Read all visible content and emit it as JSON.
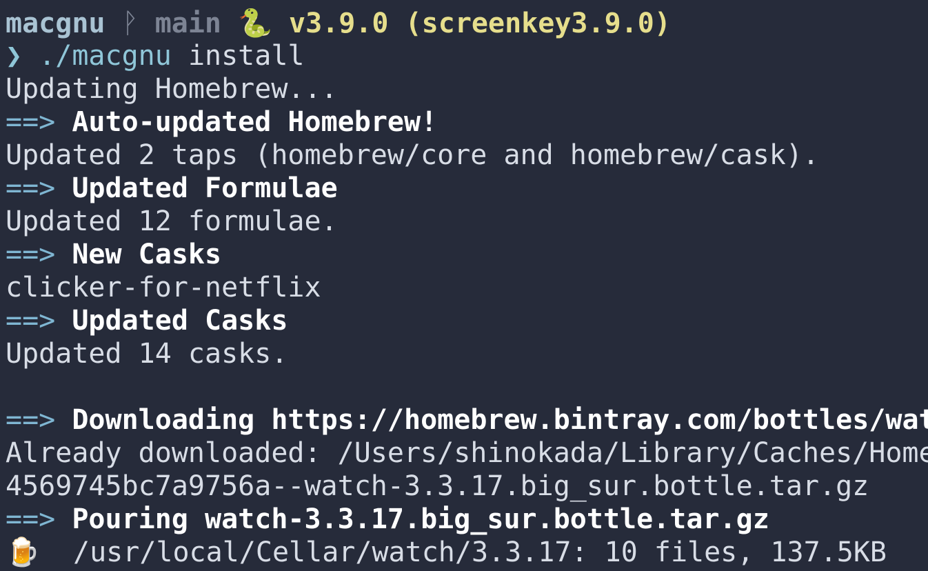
{
  "prompt": {
    "dir": "macgnu",
    "git_icon": "ᚹ",
    "branch": "main",
    "python_icon": "🐍",
    "version": "v3.9.0 (screenkey3.9.0)"
  },
  "command": {
    "caret": "❯",
    "path": "./macgnu",
    "arg": "install"
  },
  "output": {
    "l1": "Updating Homebrew...",
    "h1_arrow": "==>",
    "h1": "Auto-updated Homebrew!",
    "l2": "Updated 2 taps (homebrew/core and homebrew/cask).",
    "h2_arrow": "==>",
    "h2": "Updated Formulae",
    "l3": "Updated 12 formulae.",
    "h3_arrow": "==>",
    "h3": "New Casks",
    "l4": "clicker-for-netflix",
    "h4_arrow": "==>",
    "h4": "Updated Casks",
    "l5": "Updated 14 casks.",
    "h5_arrow": "==>",
    "h5": "Downloading https://homebrew.bintray.com/bottles/wat",
    "l6": "Already downloaded: /Users/shinokada/Library/Caches/Home",
    "l7": "4569745bc7a9756a--watch-3.3.17.big_sur.bottle.tar.gz",
    "h6_arrow": "==>",
    "h6": "Pouring watch-3.3.17.big_sur.bottle.tar.gz",
    "beer_icon": "🍺",
    "l8": "/usr/local/Cellar/watch/3.3.17: 10 files, 137.5KB"
  }
}
